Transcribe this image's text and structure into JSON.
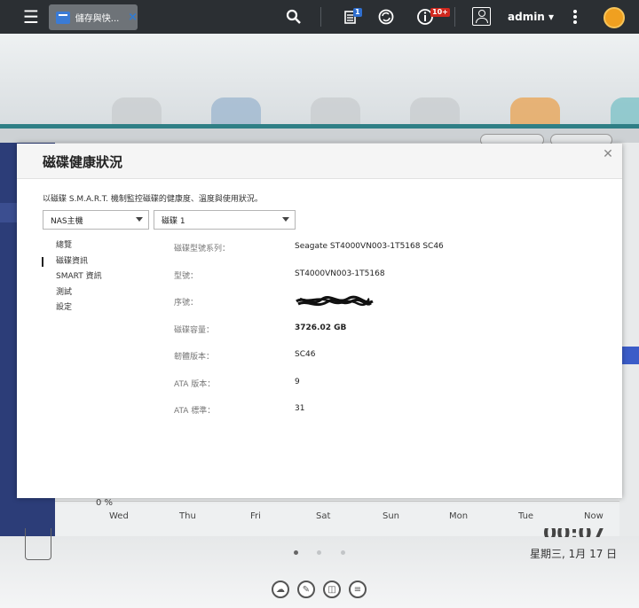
{
  "topbar": {
    "app_tab_label": "儲存與快...",
    "app_tab_close": "×",
    "notification_badge": "1",
    "info_badge": "10+",
    "username": "admin ▾"
  },
  "dashboard": {
    "chart_pct": "0 %",
    "days": [
      "Wed",
      "Thu",
      "Fri",
      "Sat",
      "Sun",
      "Mon",
      "Tue",
      "Now"
    ],
    "date": "星期三, 1月 17 日",
    "time": "00:07"
  },
  "modal": {
    "title": "磁碟健康狀況",
    "description": "以磁碟 S.M.A.R.T. 機制監控磁碟的健康度、溫度與使用狀況。",
    "host_select": "NAS主機",
    "disk_select": "磁碟 1",
    "nav": [
      "總覽",
      "磁碟資訊",
      "SMART 資訊",
      "測試",
      "設定"
    ],
    "nav_active_index": 1,
    "info": [
      {
        "label": "磁碟型號系列：",
        "value": "Seagate ST4000VN003-1T5168 SC46",
        "bold": false
      },
      {
        "label": "型號：",
        "value": "ST4000VN003-1T5168",
        "bold": false
      },
      {
        "label": "序號：",
        "value": "",
        "bold": false
      },
      {
        "label": "磁碟容量：",
        "value": "3726.02 GB",
        "bold": true
      },
      {
        "label": "韌體版本：",
        "value": "SC46",
        "bold": false
      },
      {
        "label": "ATA 版本：",
        "value": "9",
        "bold": false
      },
      {
        "label": "ATA 標準：",
        "value": "31",
        "bold": false
      }
    ]
  }
}
